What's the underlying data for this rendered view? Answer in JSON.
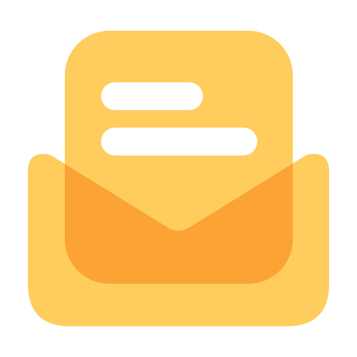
{
  "icon": {
    "name": "open-envelope-with-letter-icon",
    "colors": {
      "background": "#ffffff",
      "letter": "#fecd5d",
      "letter_lines": "#ffffff",
      "envelope_body": "#fecd5d",
      "envelope_overlap": "#fba334"
    }
  }
}
